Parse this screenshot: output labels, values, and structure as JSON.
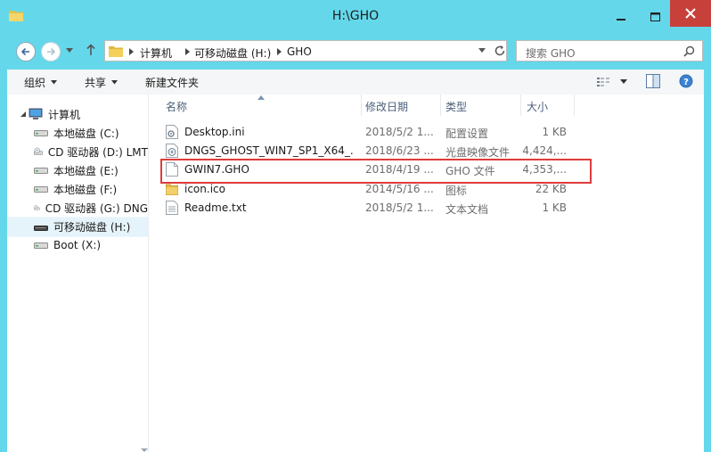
{
  "window": {
    "title": "H:\\GHO"
  },
  "address": {
    "crumbs": [
      "计算机",
      "可移动磁盘 (H:)",
      "GHO"
    ]
  },
  "search": {
    "placeholder": "搜索 GHO"
  },
  "toolbar": {
    "organize": "组织",
    "share": "共享",
    "new_folder": "新建文件夹"
  },
  "nav": {
    "computer": "计算机",
    "drives": [
      {
        "label": "本地磁盘 (C:)",
        "icon": "hard-drive-icon"
      },
      {
        "label": "CD 驱动器 (D:) LMT",
        "icon": "cd-drive-icon"
      },
      {
        "label": "本地磁盘 (E:)",
        "icon": "hard-drive-icon"
      },
      {
        "label": "本地磁盘 (F:)",
        "icon": "hard-drive-icon"
      },
      {
        "label": "CD 驱动器 (G:) DNG",
        "icon": "cd-drive-icon"
      },
      {
        "label": "可移动磁盘 (H:)",
        "icon": "usb-drive-icon",
        "selected": true
      },
      {
        "label": "Boot (X:)",
        "icon": "hard-drive-icon"
      }
    ]
  },
  "columns": {
    "name": "名称",
    "date": "修改日期",
    "type": "类型",
    "size": "大小"
  },
  "files": [
    {
      "name": "Desktop.ini",
      "date": "2018/5/2 1...",
      "type": "配置设置",
      "size": "1 KB",
      "icon": "settings-file-icon"
    },
    {
      "name": "DNGS_GHOST_WIN7_SP1_X64_...",
      "date": "2018/6/23 ...",
      "type": "光盘映像文件",
      "size": "4,424,...",
      "icon": "disc-image-icon"
    },
    {
      "name": "GWIN7.GHO",
      "date": "2018/4/19 ...",
      "type": "GHO 文件",
      "size": "4,353,...",
      "icon": "blank-file-icon"
    },
    {
      "name": "icon.ico",
      "date": "2014/5/16 ...",
      "type": "图标",
      "size": "22 KB",
      "icon": "image-file-icon"
    },
    {
      "name": "Readme.txt",
      "date": "2018/5/2 1...",
      "type": "文本文档",
      "size": "1 KB",
      "icon": "text-file-icon"
    }
  ],
  "colors": {
    "frame": "#64d8ea",
    "close": "#c7403a",
    "selection": "#e5f3fb",
    "highlight_box": "#e03b3b"
  }
}
